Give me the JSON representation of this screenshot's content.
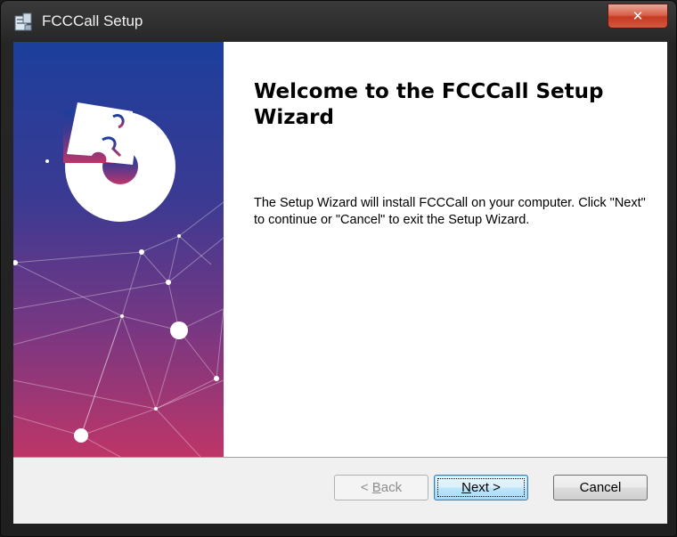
{
  "window": {
    "title": "FCCCall Setup",
    "close_label": "✕"
  },
  "content": {
    "heading": "Welcome to the FCCCall Setup Wizard",
    "description": "The Setup Wizard will install FCCCall on your computer.  Click \"Next\" to continue or \"Cancel\" to exit the Setup Wizard."
  },
  "buttons": {
    "back_prefix": "< ",
    "back_mnemonic": "B",
    "back_rest": "ack",
    "next_mnemonic": "N",
    "next_rest": "ext >",
    "cancel": "Cancel"
  },
  "colors": {
    "banner_top": "#1d3f9a",
    "banner_bottom": "#b8356a",
    "accent": "#3c7fb1"
  }
}
